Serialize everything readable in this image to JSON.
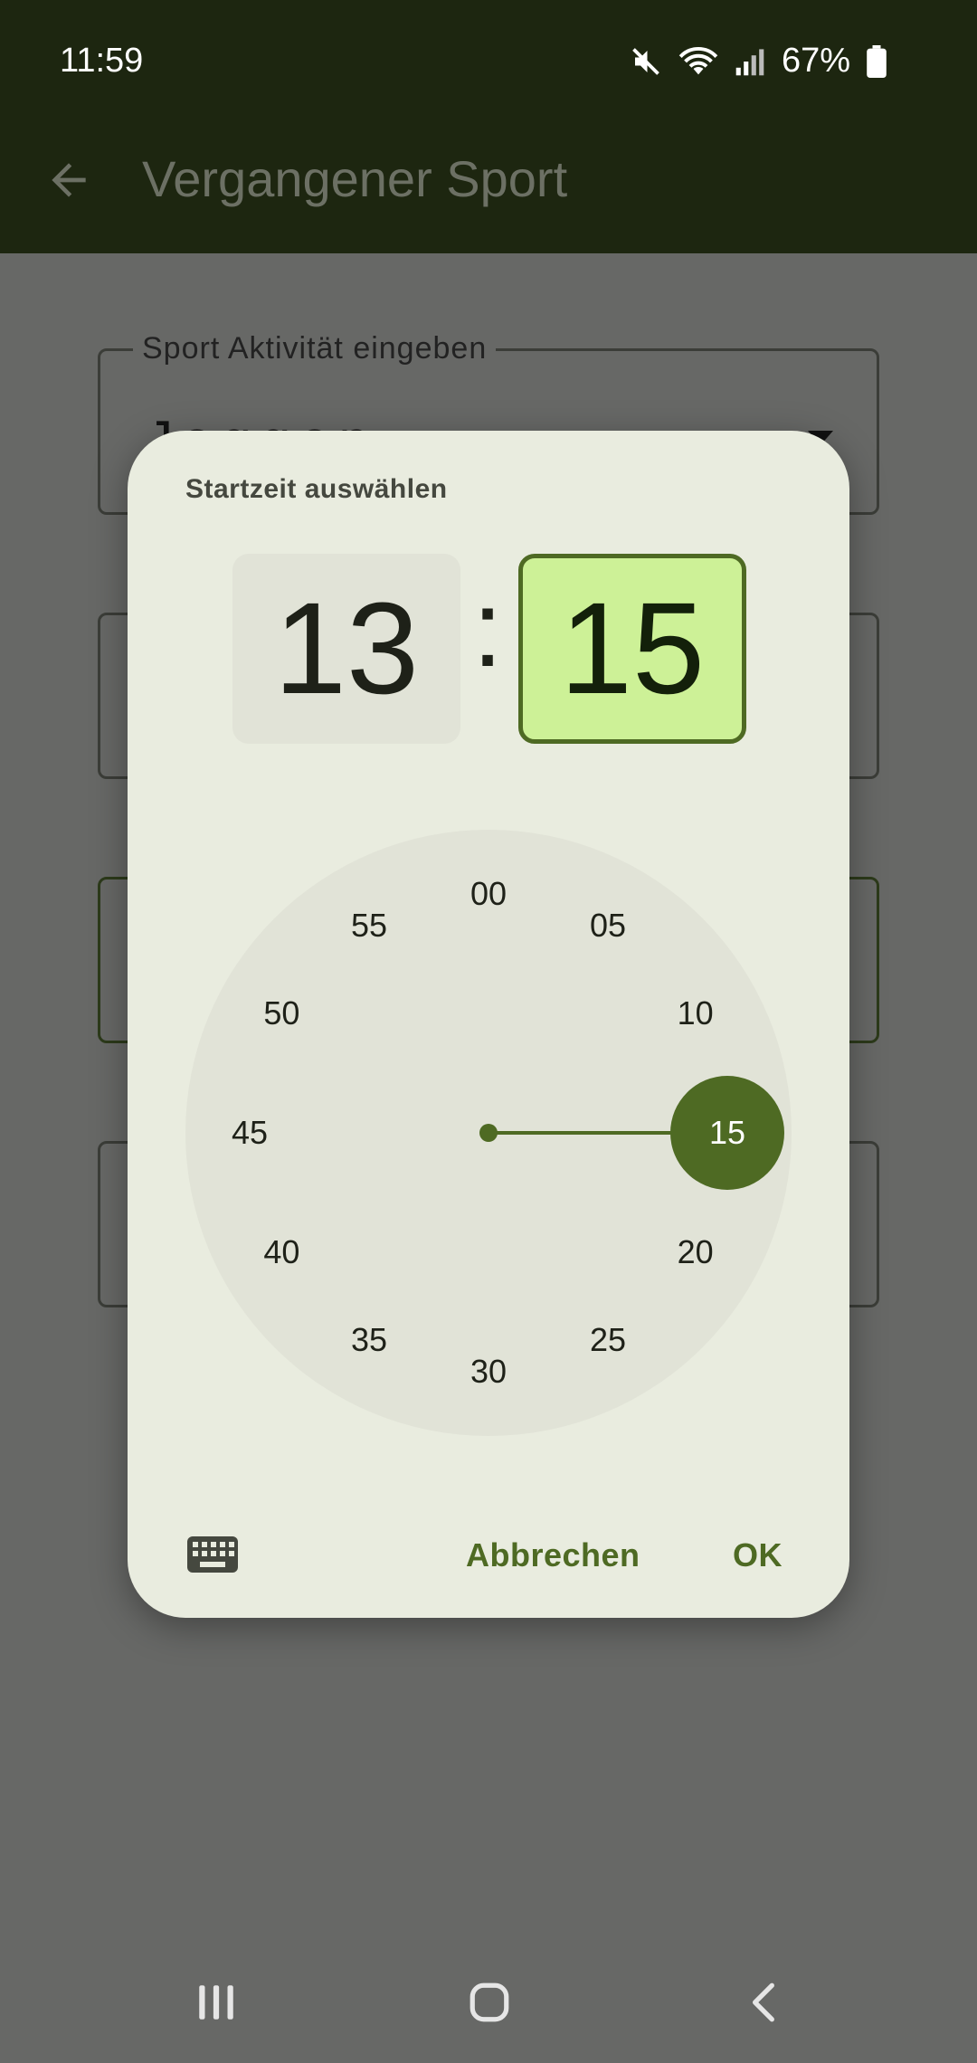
{
  "status_bar": {
    "time": "11:59",
    "battery": "67%",
    "icons": [
      "mute-icon",
      "wifi-icon",
      "signal-icon",
      "battery-icon"
    ]
  },
  "app_bar": {
    "title": "Vergangener Sport",
    "back_icon": "arrow-back-icon"
  },
  "form": {
    "fields": [
      {
        "label": "Sport Aktivität eingeben",
        "value": "Joggen"
      }
    ]
  },
  "dialog": {
    "title": "Startzeit auswählen",
    "hour": "13",
    "separator": ":",
    "minute": "15",
    "clock_numbers": [
      "00",
      "05",
      "10",
      "15",
      "20",
      "25",
      "30",
      "35",
      "40",
      "45",
      "50",
      "55"
    ],
    "selected_minute": "15",
    "keyboard_icon": "keyboard-icon",
    "cancel_label": "Abbrechen",
    "ok_label": "OK"
  },
  "colors": {
    "accent": "#4e6a23",
    "minute_box": "#cdf197",
    "dialog_bg": "#e9ecdf",
    "appbar_bg": "#1d2610"
  },
  "nav_bar": {
    "icons": [
      "recents-icon",
      "home-icon",
      "back-icon"
    ]
  }
}
